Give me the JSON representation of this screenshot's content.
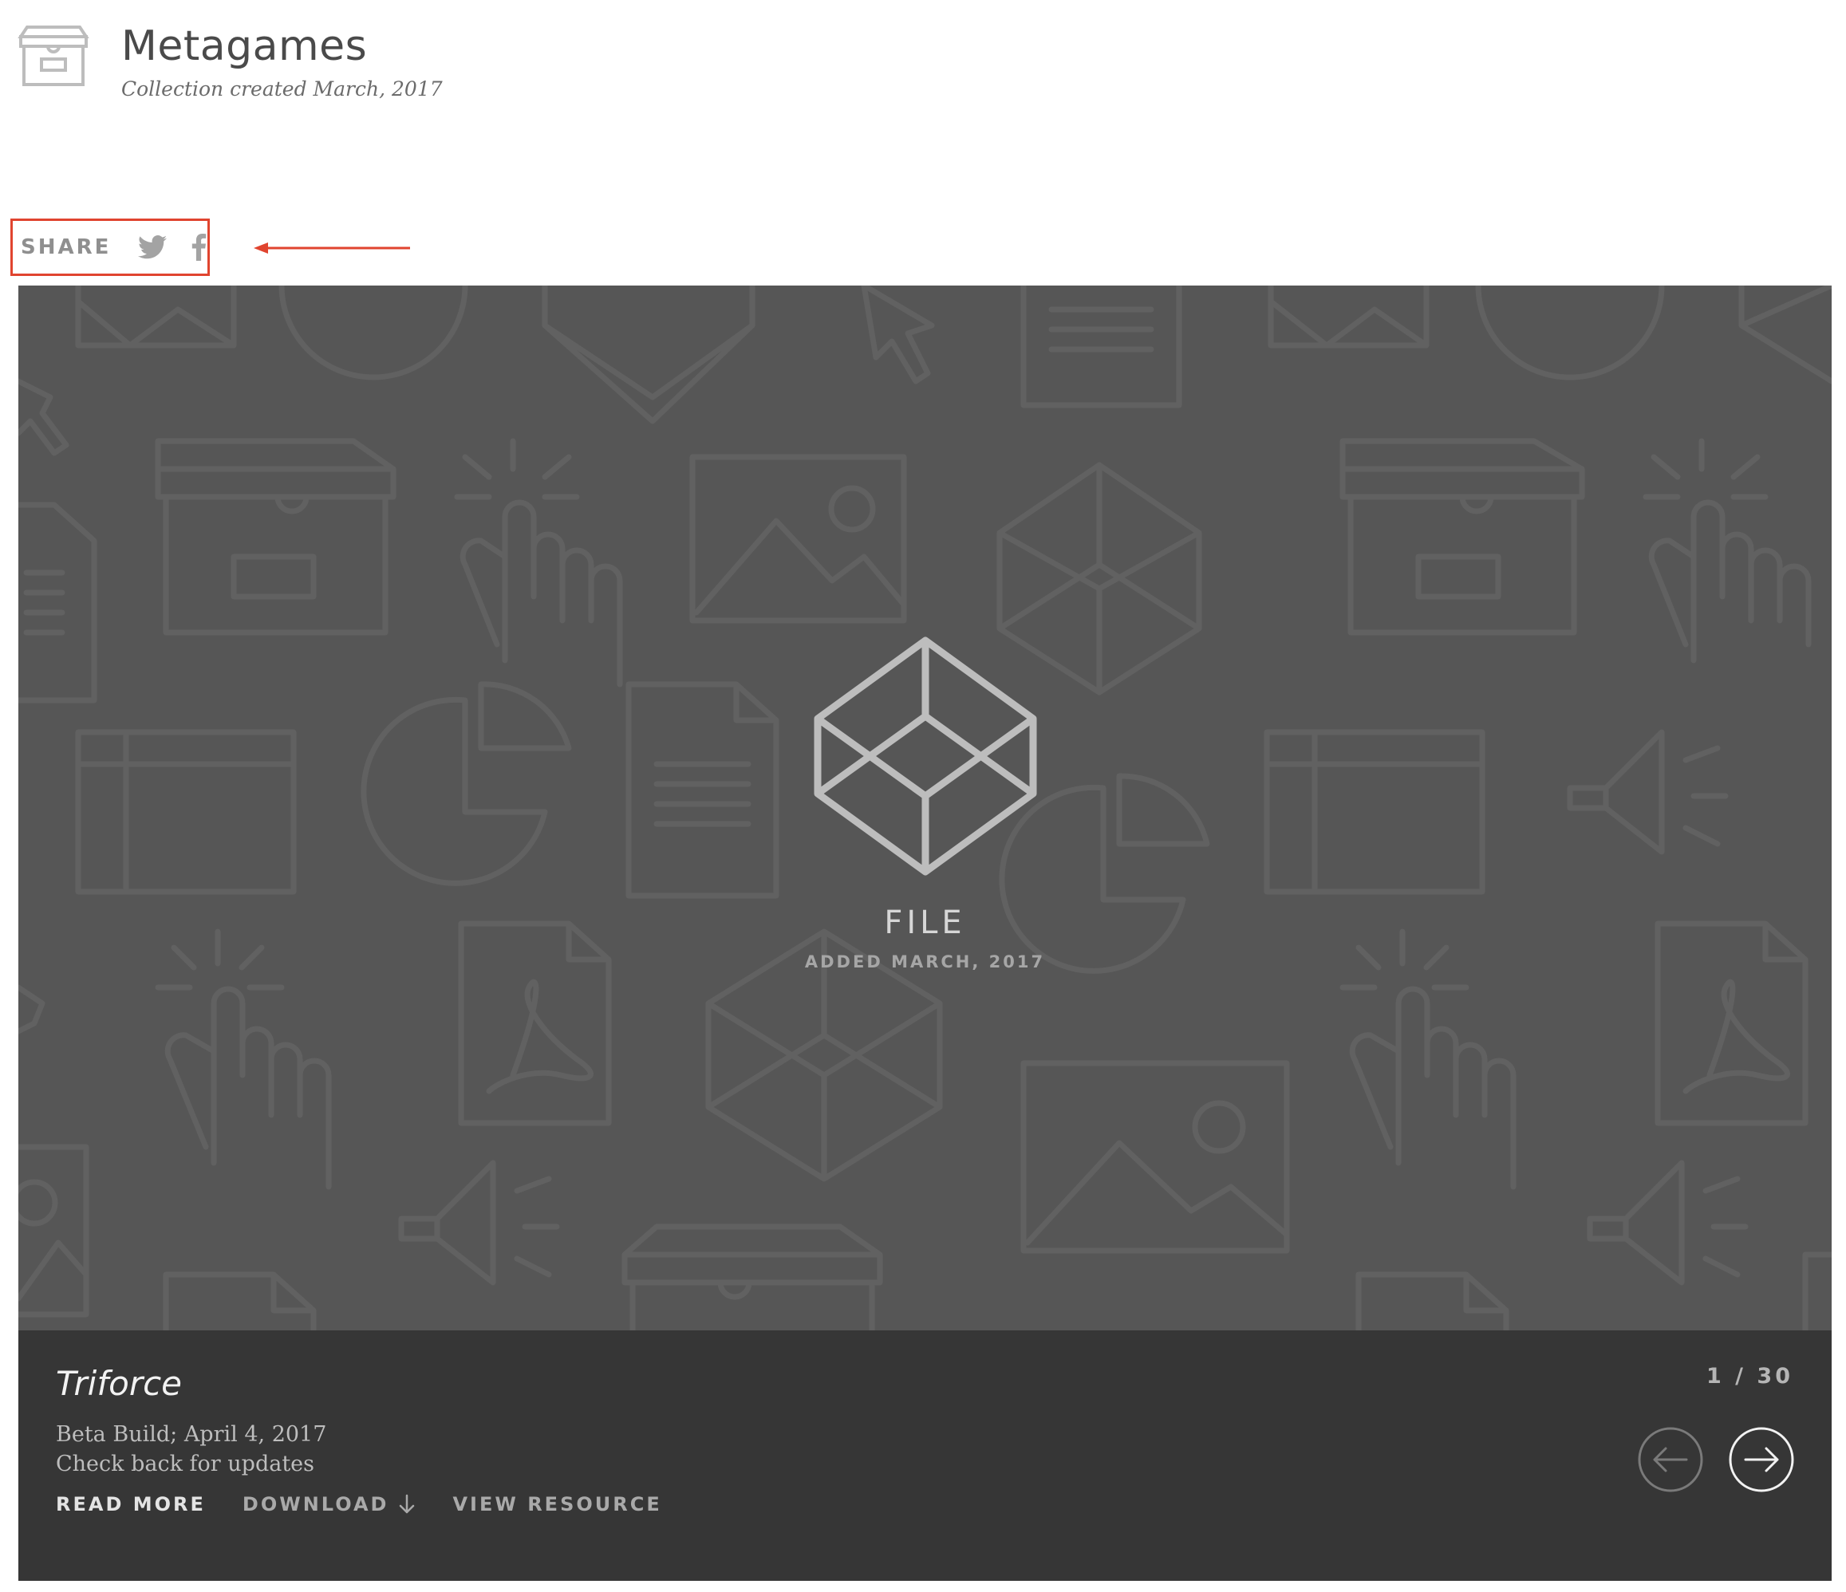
{
  "header": {
    "icon": "archive-box-icon",
    "title": "Metagames",
    "subtitle": "Collection created March, 2017"
  },
  "share": {
    "label": "SHARE",
    "icons": [
      "twitter-icon",
      "facebook-icon"
    ]
  },
  "viewer": {
    "stage": {
      "icon": "cube-icon",
      "type_label": "FILE",
      "added_label": "ADDED MARCH, 2017"
    },
    "item": {
      "title": "Triforce",
      "desc_line1": "Beta Build; April 4, 2017",
      "desc_line2": "Check back for updates"
    },
    "actions": {
      "read_more": "READ MORE",
      "download": "DOWNLOAD",
      "view_resource": "VIEW RESOURCE"
    },
    "counter": "1 / 30",
    "nav_icons": [
      "arrow-left-circle-icon",
      "arrow-right-circle-icon"
    ]
  },
  "colors": {
    "stage_bg": "#565656",
    "info_bg": "#363636",
    "annotation": "#e0442f"
  }
}
